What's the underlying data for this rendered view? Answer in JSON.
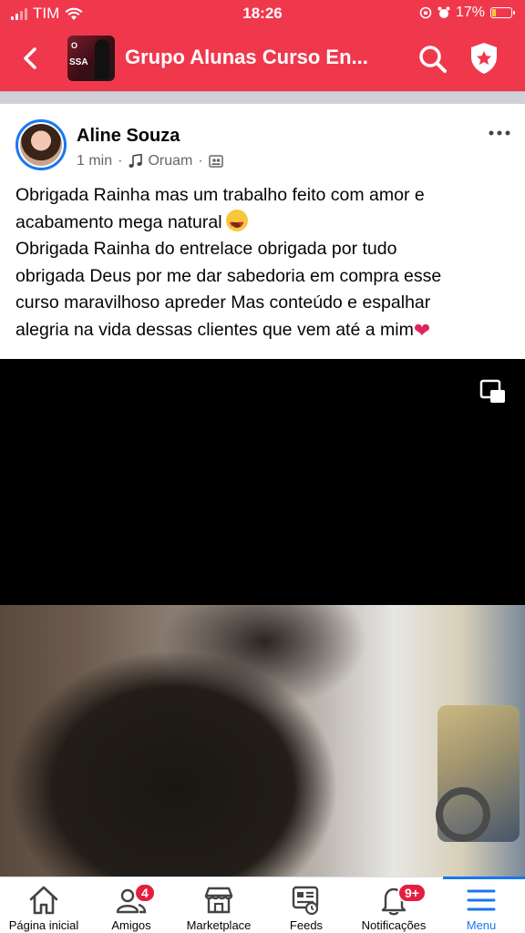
{
  "status_bar": {
    "carrier": "TIM",
    "time": "18:26",
    "battery_percent": "17%",
    "battery_level": 0.17
  },
  "header": {
    "title": "Grupo Alunas Curso  En...",
    "group_thumb_text_1": "O",
    "group_thumb_text_2": "SSA"
  },
  "post": {
    "author": "Aline Souza",
    "time": "1 min",
    "music": "Oruam",
    "text_lines": [
      "Obrigada Rainha mas um trabalho feito com amor e",
      "acabamento mega natural",
      "Obrigada Rainha do entrelace obrigada por tudo",
      "obrigada Deus por me dar sabedoria em compra esse",
      "curso maravilhoso apreder Mas conteúdo e espalhar",
      "alegria na vida dessas clientes que vem até a mim"
    ],
    "separator": "·"
  },
  "tabs": [
    {
      "label": "Página inicial",
      "icon": "home-icon",
      "badge": ""
    },
    {
      "label": "Amigos",
      "icon": "friends-icon",
      "badge": "4"
    },
    {
      "label": "Marketplace",
      "icon": "marketplace-icon",
      "badge": ""
    },
    {
      "label": "Feeds",
      "icon": "feeds-icon",
      "badge": ""
    },
    {
      "label": "Notificações",
      "icon": "bell-icon",
      "badge": "9+"
    },
    {
      "label": "Menu",
      "icon": "menu-icon",
      "badge": "",
      "active": true
    }
  ],
  "colors": {
    "header": "#f0384d",
    "accent": "#1877f2",
    "badge": "#e41e3f"
  }
}
